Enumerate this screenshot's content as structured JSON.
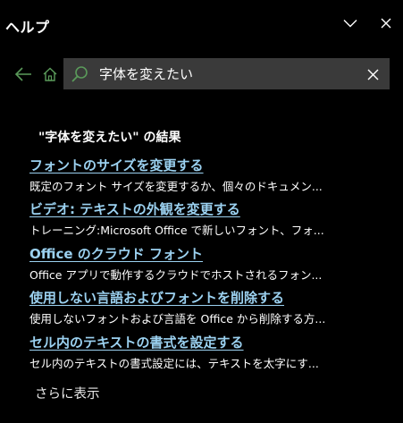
{
  "window": {
    "title": "ヘルプ",
    "collapse_icon": "chevron-down-icon",
    "close_icon": "close-icon"
  },
  "nav": {
    "back_icon": "arrow-left-icon",
    "home_icon": "home-icon",
    "accent_color": "#5a9a5a"
  },
  "search": {
    "value": "字体を変えたい",
    "search_icon": "search-icon",
    "clear_icon": "close-icon"
  },
  "results": {
    "heading": "\"字体を変えたい\" の結果",
    "link_color": "#9bd1f0",
    "items": [
      {
        "title": "フォントのサイズを変更する",
        "description": "既定のフォント サイズを変更するか、個々のドキュメン..."
      },
      {
        "title": "ビデオ: テキストの外観を変更する",
        "description": "トレーニング:Microsoft Office で新しいフォント、フォ..."
      },
      {
        "title": "Office のクラウド フォント",
        "description": "Office アプリで動作するクラウドでホストされるフォン..."
      },
      {
        "title": "使用しない言語およびフォントを削除する",
        "description": "使用しないフォントおよび言語を Office から削除する方..."
      },
      {
        "title": "セル内のテキストの書式を設定する",
        "description": "セル内のテキストの書式設定には、テキストを太字にす..."
      }
    ],
    "more_label": "さらに表示"
  }
}
